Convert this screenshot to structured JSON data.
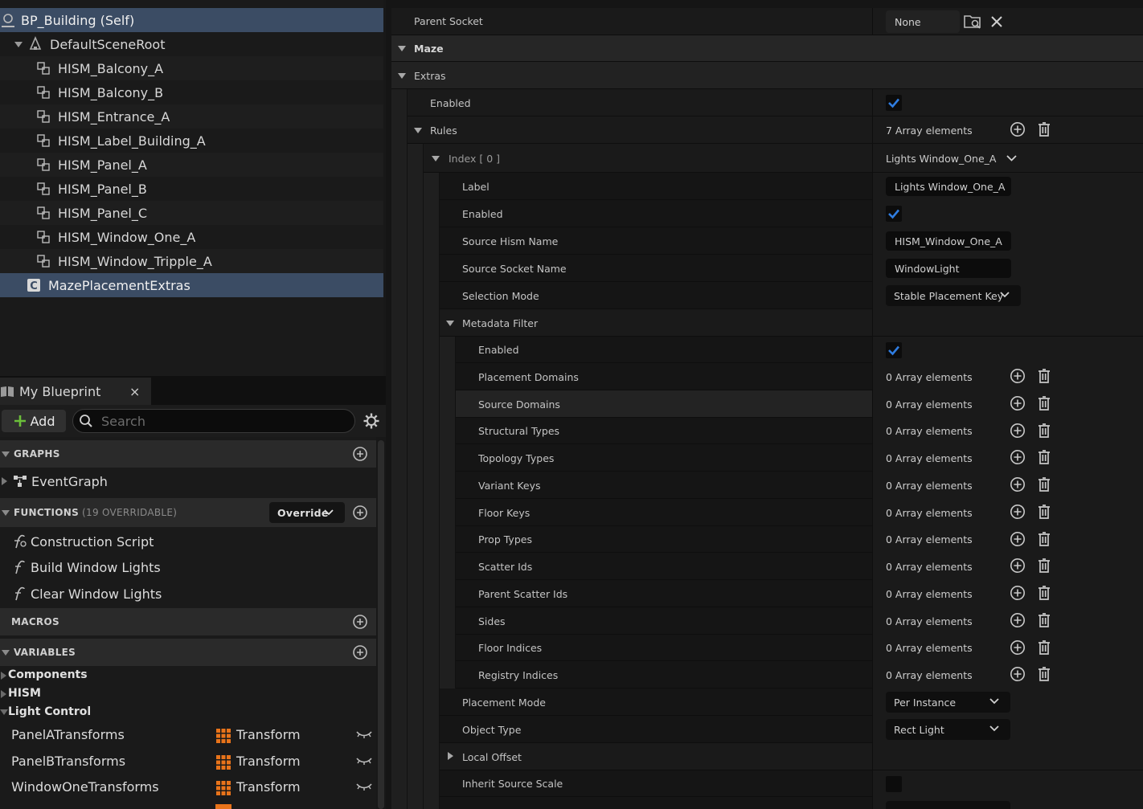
{
  "components": {
    "root": "BP_Building (Self)",
    "scene_root": "DefaultSceneRoot",
    "children": [
      "HISM_Balcony_A",
      "HISM_Balcony_B",
      "HISM_Entrance_A",
      "HISM_Label_Building_A",
      "HISM_Panel_A",
      "HISM_Panel_B",
      "HISM_Panel_C",
      "HISM_Window_One_A",
      "HISM_Window_Tripple_A"
    ],
    "selected": "MazePlacementExtras"
  },
  "my_blueprint": {
    "tab_label": "My Blueprint",
    "close_glyph": "×",
    "add_label": "Add",
    "search_placeholder": "Search",
    "graphs_label": "GRAPHS",
    "event_graph": "EventGraph",
    "functions_label": "FUNCTIONS",
    "functions_overridable": "(19 OVERRIDABLE)",
    "override_label": "Override",
    "functions": [
      "Construction Script",
      "Build Window Lights",
      "Clear Window Lights"
    ],
    "macros_label": "MACROS",
    "variables_label": "VARIABLES",
    "var_categories": [
      "Components",
      "HISM",
      "Light Control"
    ],
    "variables": [
      {
        "name": "PanelATransforms",
        "type": "Transform"
      },
      {
        "name": "PanelBTransforms",
        "type": "Transform"
      },
      {
        "name": "WindowOneTransforms",
        "type": "Transform"
      }
    ]
  },
  "details": {
    "parent_socket_label": "Parent Socket",
    "parent_socket_value": "None",
    "maze_label": "Maze",
    "extras_label": "Extras",
    "enabled_label": "Enabled",
    "rules_label": "Rules",
    "rules_value": "7 Array elements",
    "index_label": "Index [ 0 ]",
    "index_value": "Lights Window_One_A",
    "label_label": "Label",
    "label_value": "Lights Window_One_A",
    "enabled2_label": "Enabled",
    "source_hism_label": "Source Hism Name",
    "source_hism_value": "HISM_Window_One_A",
    "source_socket_label": "Source Socket Name",
    "source_socket_value": "WindowLight",
    "selection_mode_label": "Selection Mode",
    "selection_mode_value": "Stable Placement Key",
    "metadata_filter_label": "Metadata Filter",
    "mf_enabled_label": "Enabled",
    "array_rows": [
      {
        "label": "Placement Domains",
        "value": "0 Array elements"
      },
      {
        "label": "Source Domains",
        "value": "0 Array elements"
      },
      {
        "label": "Structural Types",
        "value": "0 Array elements"
      },
      {
        "label": "Topology Types",
        "value": "0 Array elements"
      },
      {
        "label": "Variant Keys",
        "value": "0 Array elements"
      },
      {
        "label": "Floor Keys",
        "value": "0 Array elements"
      },
      {
        "label": "Prop Types",
        "value": "0 Array elements"
      },
      {
        "label": "Scatter Ids",
        "value": "0 Array elements"
      },
      {
        "label": "Parent Scatter Ids",
        "value": "0 Array elements"
      },
      {
        "label": "Sides",
        "value": "0 Array elements"
      },
      {
        "label": "Floor Indices",
        "value": "0 Array elements"
      },
      {
        "label": "Registry Indices",
        "value": "0 Array elements"
      }
    ],
    "placement_mode_label": "Placement Mode",
    "placement_mode_value": "Per Instance",
    "object_type_label": "Object Type",
    "object_type_value": "Rect Light",
    "local_offset_label": "Local Offset",
    "inherit_scale_label": "Inherit Source Scale",
    "enabled_states": {
      "extras": true,
      "rule": true,
      "metadata_filter": true,
      "inherit_source_scale": false
    }
  },
  "colors": {
    "selection": "#3b4c64",
    "check": "#2f7de1",
    "add_plus": "#6bbf3a",
    "transform_type": "#e8731a"
  }
}
